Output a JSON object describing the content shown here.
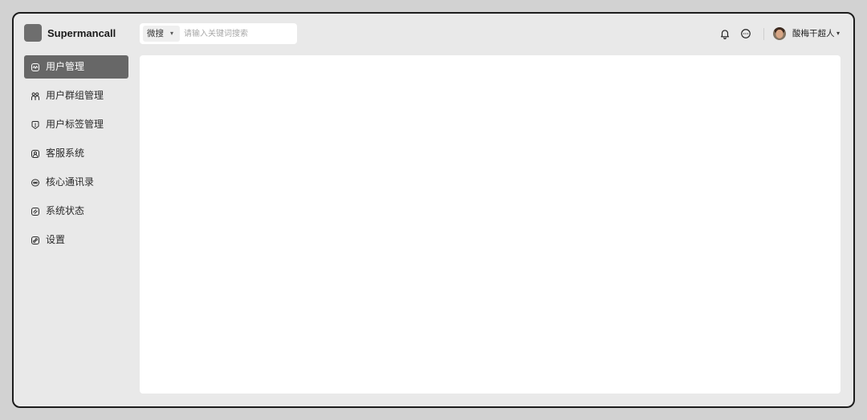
{
  "app": {
    "name": "Supermancall"
  },
  "search": {
    "scope_label": "微搜",
    "scope_caret": "▾",
    "placeholder": "请输入关键词搜索"
  },
  "header": {
    "notifications_icon": "bell-icon",
    "messages_icon": "chat-bubble-icon",
    "user": {
      "name": "酸梅干超人",
      "caret": "▾"
    }
  },
  "sidebar": {
    "items": [
      {
        "label": "用户管理",
        "icon": "activity-icon",
        "active": true
      },
      {
        "label": "用户群组管理",
        "icon": "user-group-icon",
        "active": false
      },
      {
        "label": "用户标签管理",
        "icon": "tag-icon",
        "active": false
      },
      {
        "label": "客服系统",
        "icon": "customer-service-icon",
        "active": false
      },
      {
        "label": "核心通讯录",
        "icon": "contacts-icon",
        "active": false
      },
      {
        "label": "系统状态",
        "icon": "system-status-icon",
        "active": false
      },
      {
        "label": "设置",
        "icon": "settings-icon",
        "active": false
      }
    ]
  },
  "colors": {
    "page_background": "#d2d2d2",
    "window_background": "#e9e9e9",
    "window_border": "#1c1c1c",
    "active_item_background": "#676767",
    "active_item_text": "#ffffff",
    "text": "#2a2a2a",
    "panel_background": "#ffffff",
    "logo": "#6e6e6e",
    "placeholder": "#a8a8a8"
  }
}
